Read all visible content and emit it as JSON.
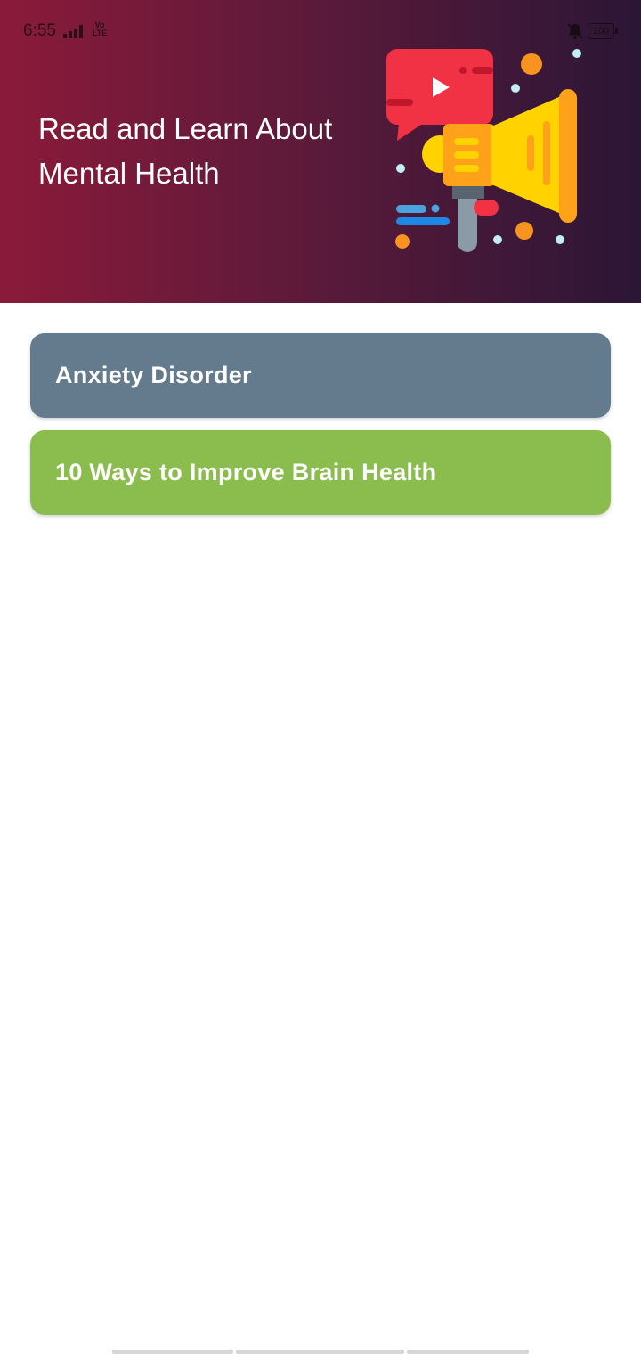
{
  "status_bar": {
    "time": "6:55",
    "network": "Vo\nLTE",
    "battery": "100"
  },
  "header": {
    "title": "Read and Learn About Mental Health",
    "background_start": "#8b1a3a",
    "background_end": "#2b1636",
    "illustration_icon": "megaphone-video-icon"
  },
  "articles": [
    {
      "label": "Anxiety Disorder",
      "color": "#637b8c"
    },
    {
      "label": "10 Ways to Improve Brain Health",
      "color": "#8bbd4e"
    }
  ]
}
